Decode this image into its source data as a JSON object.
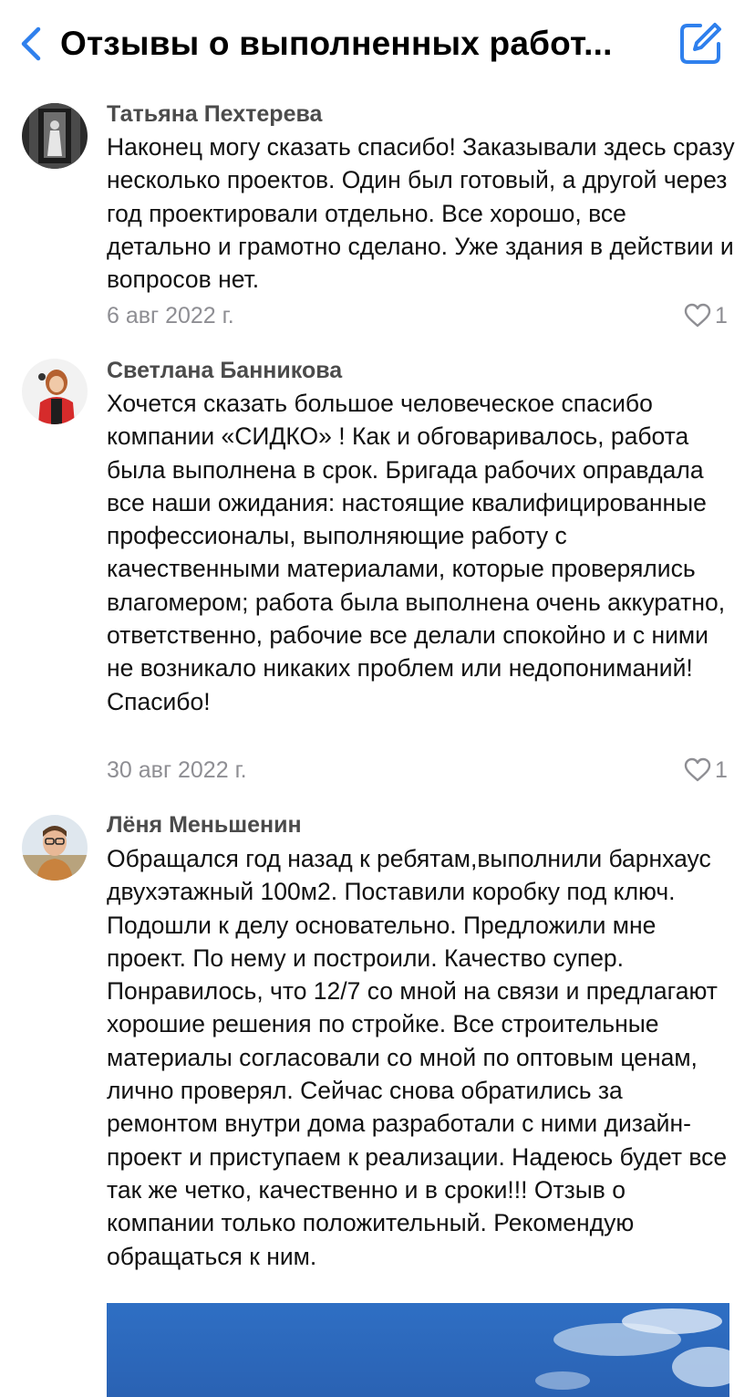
{
  "header": {
    "title": "Отзывы о выполненных работ...",
    "accent_color": "#2f80ed"
  },
  "reviews": [
    {
      "author": "Татьяна Пехтерева",
      "text": "Наконец могу сказать спасибо! Заказывали здесь сразу несколько проектов. Один был готовый, а другой через год проектировали отдельно. Все хорошо, все детально и грамотно сделано. Уже здания в действии и вопросов нет.",
      "date": "6 авг 2022 г.",
      "likes": "1"
    },
    {
      "author": "Светлана Банникова",
      "text": "Хочется сказать большое человеческое спасибо компании «СИДКО» ! Как и обговаривалось, работа была выполнена в срок. Бригада рабочих оправдала все наши ожидания: настоящие квалифицированные профессионалы, выполняющие работу с качественными материалами, которые проверялись влагомером; работа была выполнена очень аккуратно, ответственно, рабочие все делали спокойно и с ними не возникало никаких проблем или недопониманий! Спасибо!",
      "date": "30 авг 2022 г.",
      "likes": "1"
    },
    {
      "author": "Лёня Меньшенин",
      "text": "Обращался год назад к ребятам,выполнили барнхаус двухэтажный 100м2. Поставили коробку под ключ. Подошли к делу основательно. Предложили мне проект. По нему и построили. Качество супер. Понравилось, что 12/7 со мной на связи и предлагают хорошие решения по стройке. Все строительные материалы согласовали со мной по оптовым ценам, лично проверял. Сейчас снова обратились за ремонтом внутри дома разработали с ними дизайн-проект и приступаем к реализации. Надеюсь будет все так же четко, качественно и в сроки!!! Отзыв о компании только положительный. Рекомендую обращаться к ним."
    }
  ]
}
